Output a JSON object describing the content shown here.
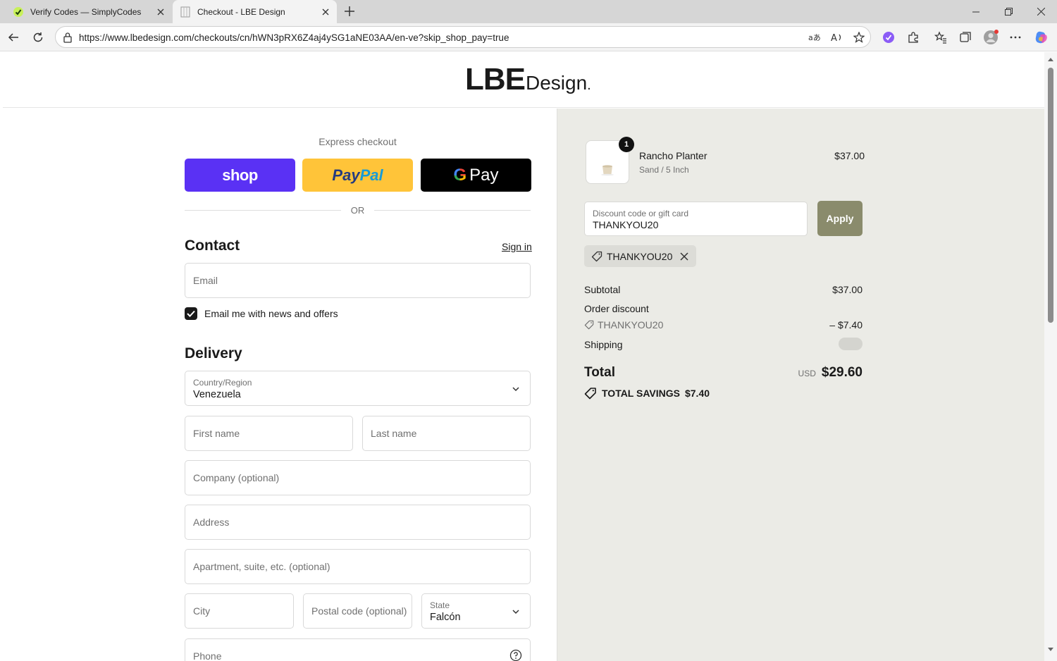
{
  "browser": {
    "tabs": [
      {
        "title": "Verify Codes — SimplyCodes",
        "icon": "simplycodes-icon",
        "active": false
      },
      {
        "title": "Checkout - LBE Design",
        "icon": "page-icon",
        "active": true
      }
    ],
    "url": "https://www.lbedesign.com/checkouts/cn/hWN3pRX6Z4aj4ySG1aNE03AA/en-ve?skip_shop_pay=true"
  },
  "store": {
    "logo_bold": "LBE",
    "logo_light": "Design",
    "logo_mark": "."
  },
  "checkout": {
    "express_label": "Express checkout",
    "shop_label": "shop",
    "paypal_part1": "Pay",
    "paypal_part2": "Pal",
    "gpay_g": "G",
    "gpay_label": "Pay",
    "or_label": "OR",
    "contact_heading": "Contact",
    "sign_in": "Sign in",
    "email_placeholder": "Email",
    "newsletter_label": "Email me with news and offers",
    "newsletter_checked": true,
    "delivery_heading": "Delivery",
    "country_label": "Country/Region",
    "country_value": "Venezuela",
    "first_name_placeholder": "First name",
    "last_name_placeholder": "Last name",
    "company_placeholder": "Company (optional)",
    "address_placeholder": "Address",
    "apartment_placeholder": "Apartment, suite, etc. (optional)",
    "city_placeholder": "City",
    "postal_placeholder": "Postal code (optional)",
    "state_label": "State",
    "state_value": "Falcón",
    "phone_placeholder": "Phone"
  },
  "order": {
    "item": {
      "name": "Rancho Planter",
      "variant": "Sand / 5 Inch",
      "price": "$37.00",
      "quantity": "1"
    },
    "discount_label": "Discount code or gift card",
    "discount_value": "THANKYOU20",
    "apply_label": "Apply",
    "applied_code": "THANKYOU20",
    "subtotal_label": "Subtotal",
    "subtotal_value": "$37.00",
    "order_discount_label": "Order discount",
    "discount_code": "THANKYOU20",
    "discount_amount": "– $7.40",
    "shipping_label": "Shipping",
    "total_label": "Total",
    "currency": "USD",
    "total_value": "$29.60",
    "savings_label": "TOTAL SAVINGS",
    "savings_value": "$7.40"
  },
  "colors": {
    "shop": "#5a31f4",
    "paypal": "#ffc439",
    "apply": "#8a8b6c",
    "summary_bg": "#ebebe6"
  }
}
